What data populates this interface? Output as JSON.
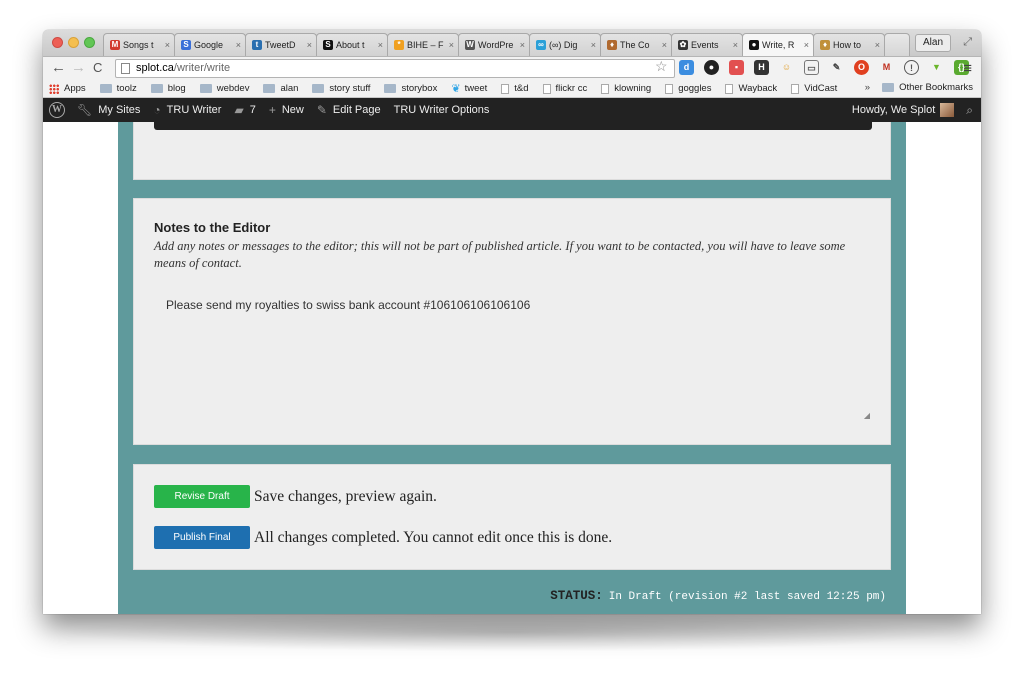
{
  "browser": {
    "tabs": [
      {
        "title": "Songs t",
        "fav": "M",
        "color": "#d23b2f"
      },
      {
        "title": "Google",
        "fav": "S",
        "color": "#3a6fd8"
      },
      {
        "title": "TweetD",
        "fav": "t",
        "color": "#2a6fb0"
      },
      {
        "title": "About t",
        "fav": "S",
        "color": "#111111"
      },
      {
        "title": "BIHE – F",
        "fav": "*",
        "color": "#f0a020"
      },
      {
        "title": "WordPre",
        "fav": "W",
        "color": "#555555"
      },
      {
        "title": "(∞) Dig",
        "fav": "∞",
        "color": "#2aa0d8"
      },
      {
        "title": "The Co",
        "fav": "♦",
        "color": "#b06a30"
      },
      {
        "title": "Events",
        "fav": "✿",
        "color": "#333333"
      },
      {
        "title": "Write, R",
        "fav": "●",
        "color": "#111111"
      },
      {
        "title": "How to",
        "fav": "♦",
        "color": "#c0903a"
      }
    ],
    "profile_name": "Alan",
    "url_host": "splot.ca",
    "url_path": "/writer/write",
    "bookmarks": [
      {
        "label": "Apps",
        "kind": "apps"
      },
      {
        "label": "toolz",
        "kind": "folder"
      },
      {
        "label": "blog",
        "kind": "folder"
      },
      {
        "label": "webdev",
        "kind": "folder"
      },
      {
        "label": "alan",
        "kind": "folder"
      },
      {
        "label": "story stuff",
        "kind": "folder"
      },
      {
        "label": "storybox",
        "kind": "folder"
      },
      {
        "label": "tweet",
        "kind": "tw"
      },
      {
        "label": "t&d",
        "kind": "doc"
      },
      {
        "label": "flickr cc",
        "kind": "doc"
      },
      {
        "label": "klowning",
        "kind": "doc"
      },
      {
        "label": "goggles",
        "kind": "doc"
      },
      {
        "label": "Wayback",
        "kind": "doc"
      },
      {
        "label": "VidCast",
        "kind": "doc"
      }
    ],
    "bookmarks_overflow": "»",
    "other_bookmarks": "Other Bookmarks"
  },
  "adminbar": {
    "my_sites": "My Sites",
    "site_name": "TRU Writer",
    "comments_count": "7",
    "new_label": "New",
    "edit_page": "Edit Page",
    "options": "TRU Writer Options",
    "howdy": "Howdy, We Splot"
  },
  "notes": {
    "title": "Notes to the Editor",
    "help": "Add any notes or messages to the editor; this will not be part of published article. If you want to be contacted, you will have to leave some means of contact.",
    "value": "Please send my royalties to swiss bank account #106106106106106"
  },
  "actions": {
    "revise_label": "Revise Draft",
    "revise_text": "Save changes, preview again.",
    "publish_label": "Publish Final",
    "publish_text": "All changes completed. You cannot edit once this is done."
  },
  "status": {
    "label": "STATUS:",
    "value": "In Draft (revision #2 last saved 12:25 pm)"
  },
  "colors": {
    "teal_bg": "#5f9a9c",
    "revise_green": "#28b44a",
    "publish_blue": "#1e6fb0",
    "adminbar": "#222222"
  }
}
